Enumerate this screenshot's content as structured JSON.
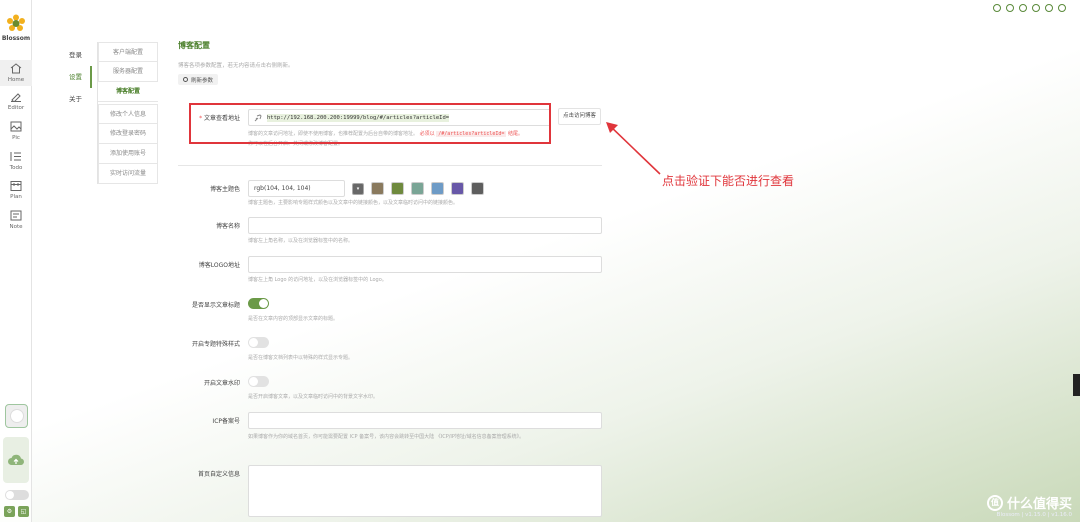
{
  "app": {
    "logo_text": "Blossom"
  },
  "rail": {
    "items": [
      {
        "label": "Home",
        "icon": "home-icon"
      },
      {
        "label": "Editor",
        "icon": "pen-icon"
      },
      {
        "label": "Pic",
        "icon": "image-icon"
      },
      {
        "label": "Todo",
        "icon": "list-icon"
      },
      {
        "label": "Plan",
        "icon": "calendar-icon"
      },
      {
        "label": "Note",
        "icon": "note-icon"
      }
    ]
  },
  "nav_primary": {
    "items": [
      "登录",
      "设置",
      "关于"
    ],
    "active": "设置"
  },
  "nav_secondary": {
    "items": [
      "客户端配置",
      "服务器配置",
      "博客配置",
      "修改个人信息",
      "修改登录密码",
      "添加使用账号",
      "实时访问流量"
    ],
    "active": "博客配置"
  },
  "main": {
    "title": "博客配置",
    "desc": "博客各项参数配置，若无内容请点击右侧刷新。",
    "refresh_label": "刷新参数"
  },
  "fields": {
    "url": {
      "required": "*",
      "label": "文章查看地址",
      "value": "http://192.168.200.200:19999/blog/#/articles?articleId=",
      "button": "点击访问博客",
      "hint_prefix": "博客的文章访问地址，即使不使用博客，也推荐配置为后台自带的博客地址。",
      "hint_must": "必须以",
      "hint_code": "/#/articles?articleId=",
      "hint_suffix": "结尾。",
      "hint2": "你可以在后台开启、关闭或修改博客配置。"
    },
    "theme_color": {
      "label": "博客主题色",
      "value": "rgb(104, 104, 104)",
      "hint": "博客主题色，主要影响专题样式颜色以及文章中的链接颜色，以及文章临时访问中的链接颜色。",
      "swatches": [
        "#8a7a5e",
        "#6f8a3e",
        "#7aa596",
        "#6e9bc6",
        "#6858a8",
        "#5e5e5e"
      ]
    },
    "name": {
      "label": "博客名称",
      "hint": "博客左上角名称，以及在浏览器标签中的名称。"
    },
    "logo": {
      "label": "博客LOGO地址",
      "hint": "博客左上角 Logo 的访问地址，以及在浏览器标签中的 Logo。"
    },
    "show_title": {
      "label": "是否显示文章标题",
      "hint": "是否在文章内容的顶部显示文章的标题。",
      "on": true
    },
    "special_style": {
      "label": "开启专题特殊样式",
      "hint": "是否在博客文档列表中以特殊的样式显示专题。",
      "on": false
    },
    "watermark": {
      "label": "开启文章水印",
      "hint": "是否开启博客文章，以及文章临时访问中的背景文字水印。",
      "on": false
    },
    "icp": {
      "label": "ICP备案号",
      "hint": "如果博客作为你的域名首页，你可能需要配置 ICP 备案号，该内容会跳转至中国大陆 《ICP/IP地址/域名信息备案管理系统》。"
    },
    "custom_info": {
      "label": "首页自定义信息"
    }
  },
  "annotation": {
    "text": "点击验证下能否进行查看",
    "color": "#e0353b"
  },
  "watermark_brand": {
    "text": "什么值得买",
    "circle": "值",
    "version": "Blossom | v1.15.0 | v1.16.0"
  }
}
